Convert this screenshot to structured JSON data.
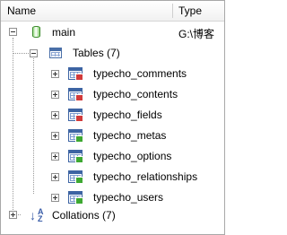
{
  "columns": {
    "name": "Name",
    "type": "Type"
  },
  "root": {
    "label": "main",
    "type_value": "G:\\博客"
  },
  "tables_node": {
    "label": "Tables (7)"
  },
  "tables": [
    {
      "label": "typecho_comments",
      "badge": "red"
    },
    {
      "label": "typecho_contents",
      "badge": "red"
    },
    {
      "label": "typecho_fields",
      "badge": "red"
    },
    {
      "label": "typecho_metas",
      "badge": "green"
    },
    {
      "label": "typecho_options",
      "badge": "green"
    },
    {
      "label": "typecho_relationships",
      "badge": "green"
    },
    {
      "label": "typecho_users",
      "badge": "green"
    }
  ],
  "collations_node": {
    "label": "Collations (7)"
  },
  "icons": {
    "root": "database-icon",
    "tables": "tables-folder-icon",
    "table": "table-icon",
    "collations": "sort-az-icon"
  },
  "colors": {
    "badge_red": "#d23a3a",
    "badge_green": "#3ea832"
  }
}
